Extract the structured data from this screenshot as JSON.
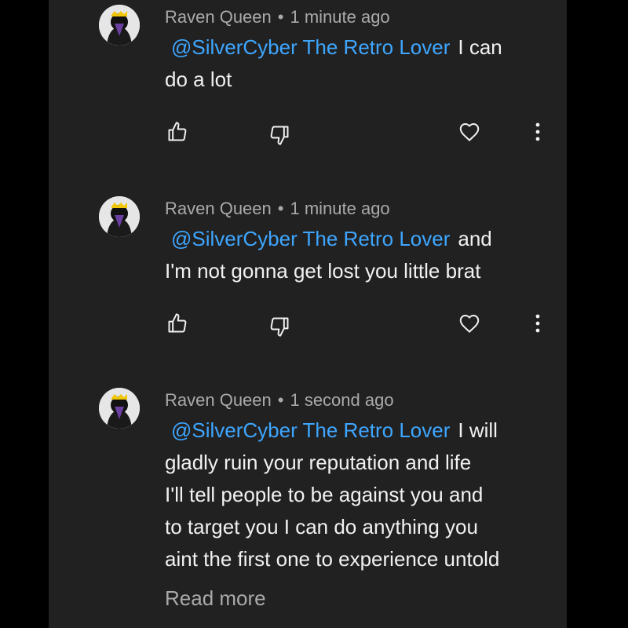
{
  "comments": [
    {
      "author": "Raven Queen",
      "separator": "•",
      "time": "1 minute ago",
      "mention": "@SilverCyber The Retro Lover",
      "lines": [
        "I can",
        "do a lot"
      ]
    },
    {
      "author": "Raven Queen",
      "separator": "•",
      "time": "1 minute ago",
      "mention": "@SilverCyber The Retro Lover",
      "lines": [
        "and",
        "I'm not gonna get lost you little brat"
      ]
    },
    {
      "author": "Raven Queen",
      "separator": "•",
      "time": "1 second ago",
      "mention": "@SilverCyber The Retro Lover",
      "lines": [
        "I will",
        "gladly ruin your reputation and life",
        "I'll tell people to be against you and",
        "to target you I can do anything you",
        "aint the first one to experience untold"
      ],
      "read_more": "Read more"
    }
  ],
  "icons": {
    "like": "thumbs-up-icon",
    "dislike": "thumbs-down-icon",
    "heart": "heart-icon",
    "more": "more-vert-icon"
  },
  "colors": {
    "background": "#212121",
    "mention": "#3ea6ff",
    "text": "#f1f1f1",
    "meta": "#aaaaaa"
  }
}
